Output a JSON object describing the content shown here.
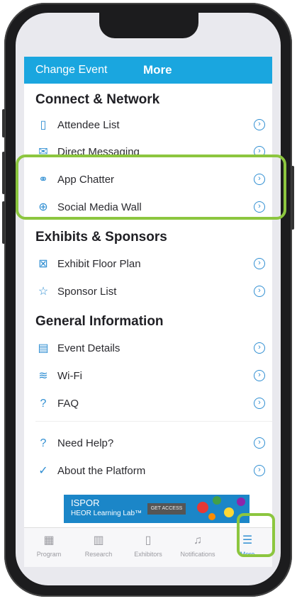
{
  "header": {
    "change_event": "Change Event",
    "title": "More"
  },
  "sections": [
    {
      "title": "Connect & Network",
      "items": [
        {
          "label": "Attendee List",
          "icon": "attendee-list-icon"
        },
        {
          "label": "Direct Messaging",
          "icon": "direct-messaging-icon"
        },
        {
          "label": "App Chatter",
          "icon": "app-chatter-icon"
        },
        {
          "label": "Social Media Wall",
          "icon": "globe-icon"
        }
      ]
    },
    {
      "title": "Exhibits & Sponsors",
      "items": [
        {
          "label": "Exhibit Floor Plan",
          "icon": "floor-plan-icon"
        },
        {
          "label": "Sponsor List",
          "icon": "star-icon"
        }
      ]
    },
    {
      "title": "General Information",
      "items": [
        {
          "label": "Event Details",
          "icon": "calendar-icon"
        },
        {
          "label": "Wi-Fi",
          "icon": "wifi-icon"
        },
        {
          "label": "FAQ",
          "icon": "question-icon"
        }
      ]
    },
    {
      "title": "",
      "items": [
        {
          "label": "Need Help?",
          "icon": "help-icon"
        },
        {
          "label": "About the Platform",
          "icon": "check-circle-icon"
        }
      ]
    }
  ],
  "banner": {
    "brand": "ISPOR",
    "subtitle": "HEOR Learning Lab™",
    "cta": "GET ACCESS"
  },
  "tabs": [
    {
      "label": "Program",
      "icon": "program-icon"
    },
    {
      "label": "Research",
      "icon": "research-icon"
    },
    {
      "label": "Exhibitors",
      "icon": "exhibitors-icon"
    },
    {
      "label": "Notifications",
      "icon": "bell-icon"
    },
    {
      "label": "More",
      "icon": "menu-icon",
      "active": true
    }
  ],
  "colors": {
    "accent": "#1aa6df",
    "icon": "#2f8ed2",
    "highlight": "#8cc63f"
  }
}
